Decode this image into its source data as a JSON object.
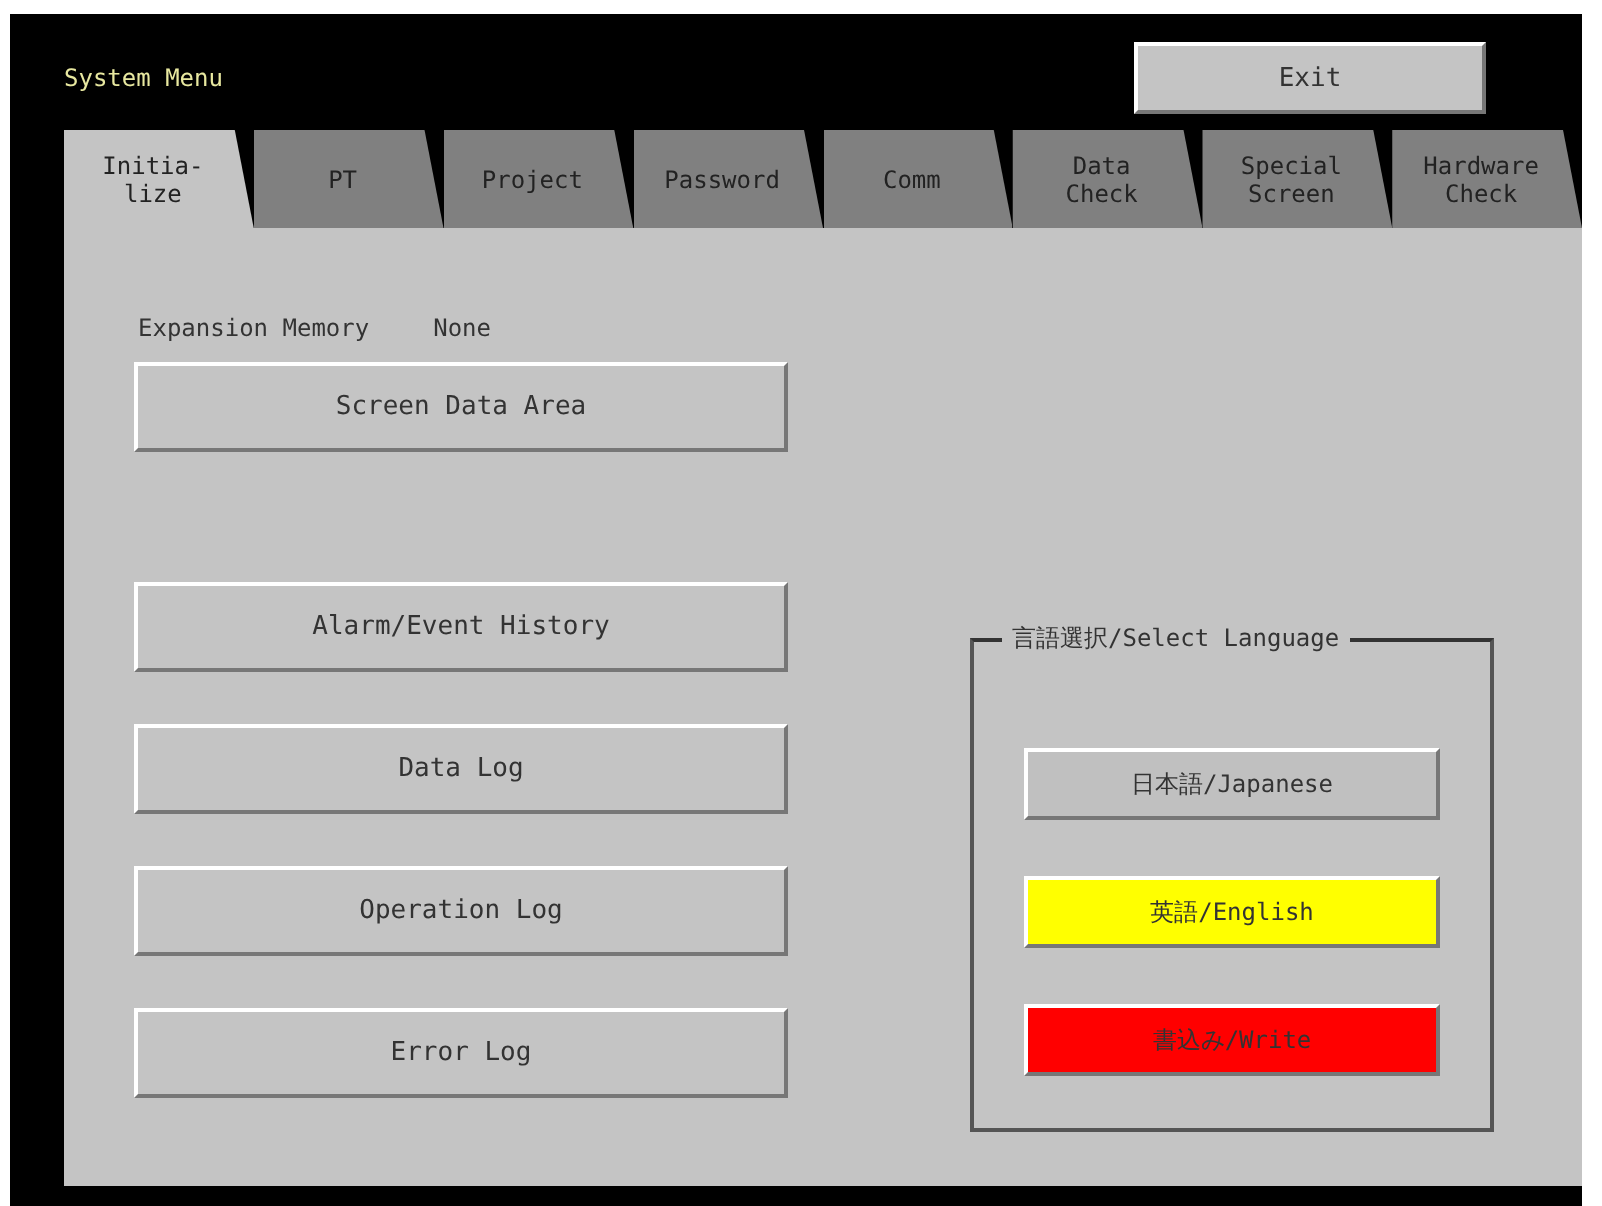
{
  "window": {
    "title": "System Menu"
  },
  "exit_button": "Exit",
  "tabs": [
    {
      "label": "Initia-\nlize",
      "selected": true
    },
    {
      "label": "PT",
      "selected": false
    },
    {
      "label": "Project",
      "selected": false
    },
    {
      "label": "Password",
      "selected": false
    },
    {
      "label": "Comm",
      "selected": false
    },
    {
      "label": "Data\nCheck",
      "selected": false
    },
    {
      "label": "Special\nScreen",
      "selected": false
    },
    {
      "label": "Hardware\nCheck",
      "selected": false
    }
  ],
  "expansion_memory": {
    "label": "Expansion Memory",
    "value": "None"
  },
  "screen_data_button": "Screen Data Area",
  "log_buttons": [
    "Alarm/Event History",
    "Data Log",
    "Operation Log",
    "Error Log"
  ],
  "language_group": {
    "title": "言語選択/Select  Language",
    "buttons": [
      {
        "label": "日本語/Japanese",
        "color": "#c0c0c0"
      },
      {
        "label": "英語/English",
        "color": "#ffff00"
      },
      {
        "label": "書込み/Write",
        "color": "#ff0000"
      }
    ]
  }
}
